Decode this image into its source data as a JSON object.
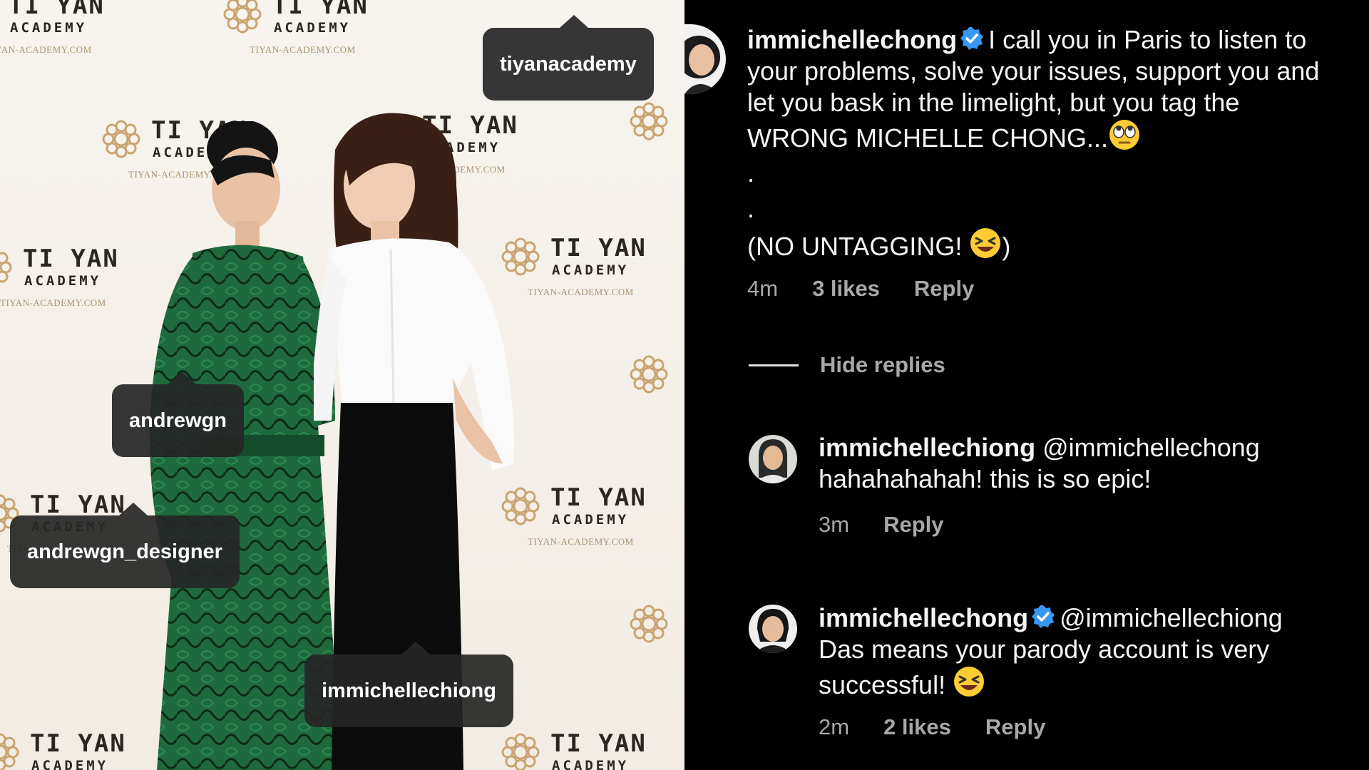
{
  "photo": {
    "backdrop_brand": "TI YAN",
    "backdrop_sub": "ACADEMY",
    "backdrop_url": "TIYAN-ACADEMY.COM",
    "tags": [
      "tiyanacademy",
      "andrewgn",
      "andrewgn_designer",
      "immichellechiong"
    ]
  },
  "comments": {
    "main": {
      "username": "immichellechong",
      "text": "I call you in Paris to listen to your problems, solve your issues, support you and let you bask in the limelight, but you tag the WRONG MICHELLE CHONG...",
      "dot1": ".",
      "dot2": ".",
      "text2": "(NO UNTAGGING!",
      "text2_end": ")",
      "time": "4m",
      "likes": "3 likes",
      "reply": "Reply"
    },
    "hide_replies": "Hide replies",
    "reply1": {
      "username": "immichellechiong",
      "mention": "@immichellechong",
      "text": "hahahahahah! this is so epic!",
      "time": "3m",
      "reply": "Reply"
    },
    "reply2": {
      "username": "immichellechong",
      "mention": "@immichellechiong",
      "text": "Das means your parody account is very successful!",
      "time": "2m",
      "likes": "2 likes",
      "reply": "Reply"
    }
  },
  "colors": {
    "verified": "#3897f0",
    "meta": "#a8a8a8",
    "tag_bg": "#262626"
  },
  "icons": [
    "verified-badge-icon",
    "eye-roll-emoji-icon",
    "laughing-emoji-icon"
  ]
}
